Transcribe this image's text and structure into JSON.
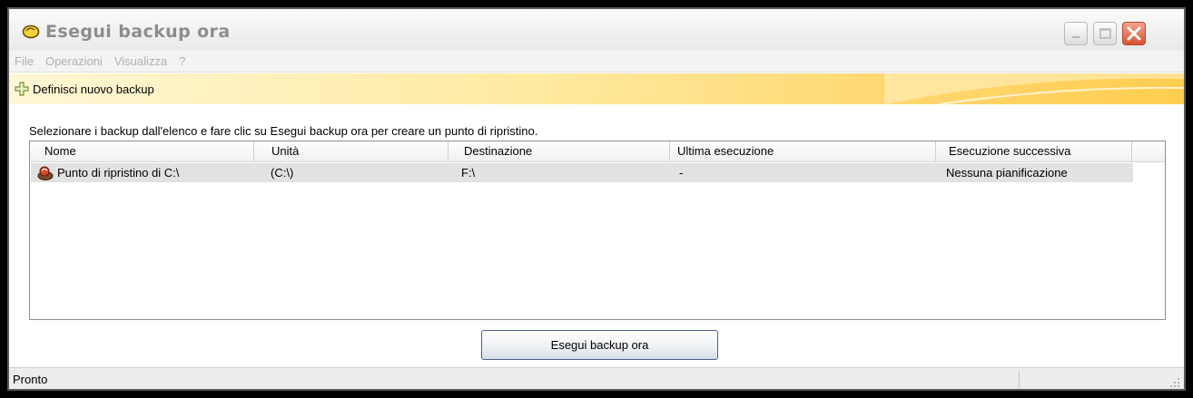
{
  "window": {
    "title": "Esegui backup ora",
    "app_icon": "backup-app-icon",
    "controls": [
      "minimize-icon",
      "maximize-icon",
      "close-icon"
    ]
  },
  "menu": {
    "items": [
      "File",
      "Operazioni",
      "Visualizza",
      "?"
    ]
  },
  "toolbar": {
    "add_icon": "plus-icon",
    "add_label": "Definisci nuovo backup"
  },
  "instructions": "Selezionare i backup dall'elenco e fare clic su Esegui backup ora per creare un punto di ripristino.",
  "list": {
    "columns": [
      "Nome",
      "Unità",
      "Destinazione",
      "Ultima esecuzione",
      "Esecuzione successiva"
    ],
    "rows": [
      {
        "icon": "restore-point-icon",
        "nome": "Punto di ripristino di C:\\",
        "unita": "(C:\\)",
        "destinazione": "F:\\",
        "ultima": "-",
        "successiva": "Nessuna pianificazione"
      }
    ]
  },
  "button": {
    "run_label": "Esegui backup ora"
  },
  "status": {
    "text": "Pronto"
  },
  "colors": {
    "toolbar_accent": "#ffd56a",
    "title_text": "#8d8d8d",
    "menu_text": "#b0b0b0",
    "row_selected": "#e2e2e2",
    "close_button": "#d6542f"
  }
}
